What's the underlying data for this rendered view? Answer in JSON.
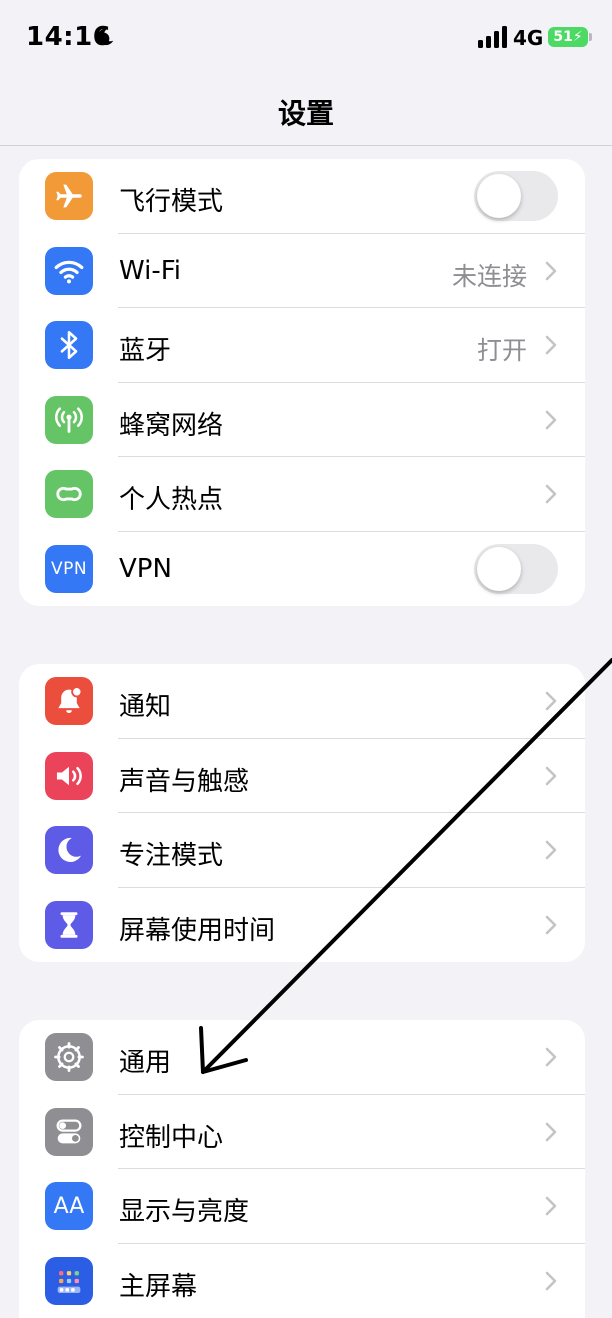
{
  "status_bar": {
    "time": "14:16",
    "network": "4G",
    "battery": "51"
  },
  "nav": {
    "title": "设置"
  },
  "groups": [
    {
      "rows": [
        {
          "label": "飞行模式",
          "icon": "airplane-icon",
          "color": "#f19a37",
          "control": "toggle",
          "on": false
        },
        {
          "label": "Wi-Fi",
          "icon": "wifi-icon",
          "color": "#3478f6",
          "value": "未连接"
        },
        {
          "label": "蓝牙",
          "icon": "bluetooth-icon",
          "color": "#3478f6",
          "value": "打开"
        },
        {
          "label": "蜂窝网络",
          "icon": "cellular-icon",
          "color": "#65c466"
        },
        {
          "label": "个人热点",
          "icon": "hotspot-icon",
          "color": "#65c466"
        },
        {
          "label": "VPN",
          "icon": "vpn-icon",
          "icon_text": "VPN",
          "color": "#3478f6",
          "control": "toggle",
          "on": false
        }
      ]
    },
    {
      "rows": [
        {
          "label": "通知",
          "icon": "notifications-icon",
          "color": "#eb4e3d"
        },
        {
          "label": "声音与触感",
          "icon": "sound-icon",
          "color": "#eb445a"
        },
        {
          "label": "专注模式",
          "icon": "focus-moon-icon",
          "color": "#5e5ce6"
        },
        {
          "label": "屏幕使用时间",
          "icon": "hourglass-icon",
          "color": "#5e5ce6"
        }
      ]
    },
    {
      "rows": [
        {
          "label": "通用",
          "icon": "gear-icon",
          "color": "#8e8e93"
        },
        {
          "label": "控制中心",
          "icon": "control-center-icon",
          "color": "#8e8e93"
        },
        {
          "label": "显示与亮度",
          "icon": "display-icon",
          "icon_text": "AA",
          "color": "#3478f6"
        },
        {
          "label": "主屏幕",
          "icon": "home-screen-icon",
          "color": "#2c5de5"
        }
      ]
    }
  ]
}
